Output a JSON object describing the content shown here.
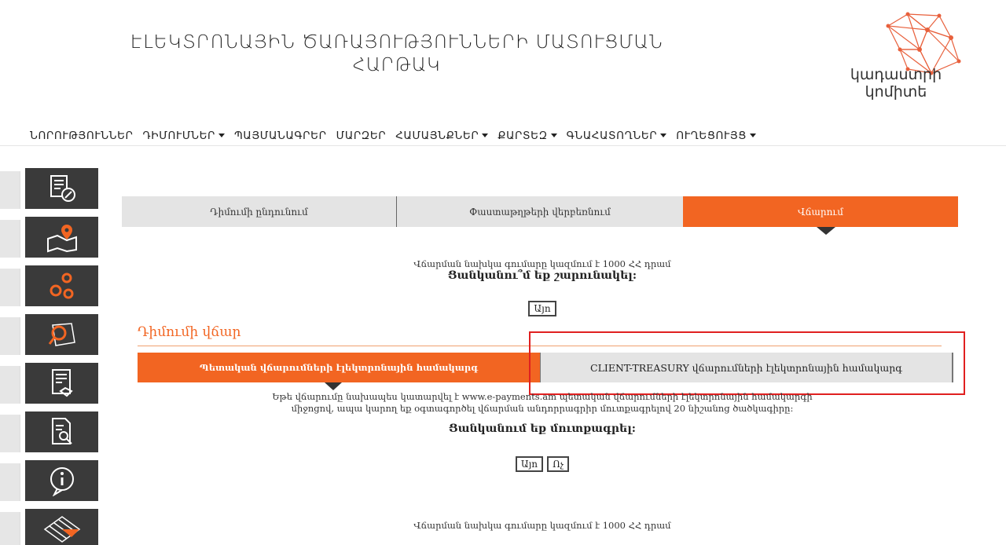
{
  "header": {
    "title_line1": "ԷԼԵԿՏՐՈՆԱՅԻՆ ԾԱՌԱՅՈՒԹՅՈՒՆՆԵՐԻ ՄԱՏՈՒՑՄԱՆ",
    "title_line2": "ՀԱՐԹԱԿ",
    "logo_line1": "կադաստրի",
    "logo_line2": "կոմիտե",
    "logo_color": "#e8603c"
  },
  "nav": {
    "items": [
      {
        "label": "ՆՈՐՈՒԹՅՈՒՆՆԵՐ",
        "dropdown": false
      },
      {
        "label": "ԴԻՄՈՒՄՆԵՐ",
        "dropdown": true
      },
      {
        "label": "ՊԱՅՄԱՆԱԳՐԵՐ",
        "dropdown": false
      },
      {
        "label": "ՄԱՐԶԵՐ",
        "dropdown": false
      },
      {
        "label": "ՀԱՄԱՅՆՔՆԵՐ",
        "dropdown": true
      },
      {
        "label": "ՔԱՐՏԵԶ",
        "dropdown": true
      },
      {
        "label": "ԳՆԱՀԱՏՈՂՆԵՐ",
        "dropdown": true
      },
      {
        "label": "ՈՒՂԵՑՈՒՅՑ",
        "dropdown": true
      }
    ]
  },
  "sidebar": {
    "icons": [
      "document-edit-icon",
      "map-pin-icon",
      "gears-icon",
      "map-search-icon",
      "document-handshake-icon",
      "document-search-icon",
      "info-icon",
      "cadastre-map-icon"
    ]
  },
  "tabs": {
    "tab1": "Դիմումի ընդունում",
    "tab2": "Փաստաթղթերի վերբեռնում",
    "tab3": "Վճարում"
  },
  "payment": {
    "amount_text": "Վճարման նախկա գումարը կազմում է 1000 ՀՀ դրամ",
    "continue_question": "Ցանկանու՞մ եք շարունակել:",
    "yes_button": "Այո"
  },
  "section": {
    "title": "Դիմումի վճար",
    "subtab1": "Պետական վճարումների էլեկտրոնային համակարգ",
    "subtab2": "CLIENT-TREASURY վճարումների էլեկտրոնային համակարգ"
  },
  "info": {
    "line1": "Եթե վճարումը նախապես կատարվել է www.e-payments.am պետական վճարումների էլեկտրոնային համակարգի",
    "line2": "միջոցով, ապա կարող եք օգտագործել վճարման անդորրագրիր մուտքագրելով 20 նիշանոց ծածկագիրը:",
    "question": "Ցանկանում եք մուտքագրել:",
    "yes_button": "Այո",
    "no_button": "Ոչ",
    "footer_amount": "Վճարման նախկա գումարը կազմում է 1000 ՀՀ դրամ"
  },
  "colors": {
    "accent": "#f26522",
    "sidebar_icon_bg": "#3a3a3a",
    "highlight_border": "#e02020"
  }
}
